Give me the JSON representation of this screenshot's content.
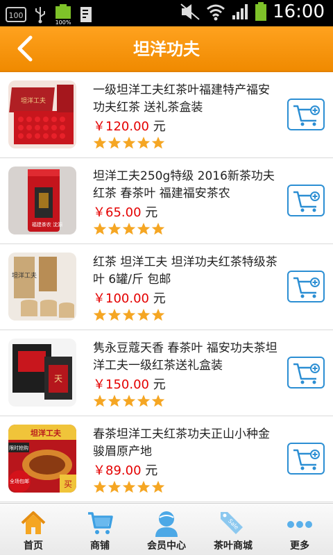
{
  "status_bar": {
    "time": "16:00",
    "battery_label": "100%",
    "icon_100": "100"
  },
  "header": {
    "title": "坦洋功夫"
  },
  "products": [
    {
      "title": "一级坦洋工夫红茶叶福建特产福安功夫红茶 送礼茶盒装",
      "price": "￥120.00",
      "unit": " 元",
      "rating": 5
    },
    {
      "title": "坦洋工夫250g特级 2016新茶功夫红茶 春茶叶 福建福安茶农",
      "price": "￥65.00",
      "unit": " 元",
      "rating": 5
    },
    {
      "title": "红茶 坦洋工夫 坦洋功夫红茶特级茶叶 6罐/斤 包邮",
      "price": "￥100.00",
      "unit": " 元",
      "rating": 5
    },
    {
      "title": "隽永豆蔻天香 春茶叶 福安功夫茶坦洋工夫一级红茶送礼盒装",
      "price": "￥150.00",
      "unit": " 元",
      "rating": 5
    },
    {
      "title": "春茶坦洋工夫红茶功夫正山小种金骏眉原产地",
      "price": "￥89.00",
      "unit": " 元",
      "rating": 5
    }
  ],
  "thumbnail_text": {
    "p1_box": "坦洋工夫",
    "p2_caption": "福建茶农 沈源",
    "p3_can": "坦洋工夫",
    "p4_box": "天",
    "p5_banner": "坦洋工夫",
    "p5_badge1": "限时抢购",
    "p5_badge2": "全场包邮",
    "p5_badge3": "买"
  },
  "tabbar": {
    "tabs": [
      {
        "label": "首页",
        "icon": "home-icon"
      },
      {
        "label": "商铺",
        "icon": "cart-icon"
      },
      {
        "label": "会员中心",
        "icon": "user-icon"
      },
      {
        "label": "茶叶商城",
        "icon": "sale-tag-icon"
      },
      {
        "label": "更多",
        "icon": "more-dots-icon"
      }
    ]
  },
  "colors": {
    "header_orange": "#f59300",
    "price_red": "#e40000",
    "cart_blue": "#2b8ed3",
    "star": "#f5a623"
  }
}
